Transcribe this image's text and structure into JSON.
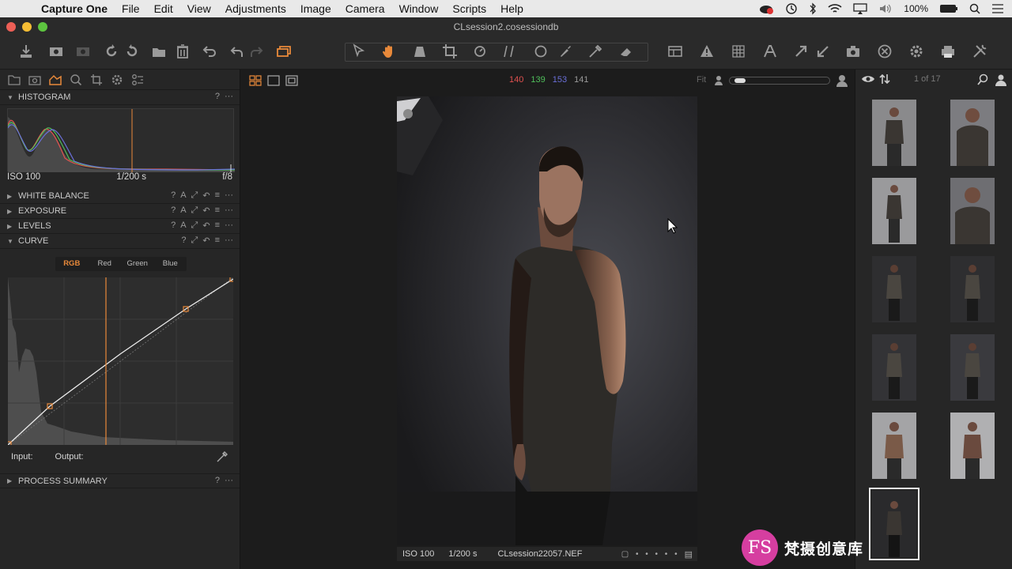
{
  "menubar": {
    "items": [
      "Capture One",
      "File",
      "Edit",
      "View",
      "Adjustments",
      "Image",
      "Camera",
      "Window",
      "Scripts",
      "Help"
    ],
    "battery": "100%"
  },
  "window": {
    "title": "CLsession2.cosessiondb"
  },
  "histogram": {
    "title": "HISTOGRAM",
    "iso": "ISO 100",
    "shutter": "1/200 s",
    "aperture": "f/8"
  },
  "tools": {
    "white_balance": "WHITE BALANCE",
    "exposure": "EXPOSURE",
    "levels": "LEVELS",
    "curve": "CURVE",
    "process_summary": "PROCESS SUMMARY",
    "help": "?",
    "more": "···",
    "auto": "A"
  },
  "curve": {
    "tabs": [
      "RGB",
      "Red",
      "Green",
      "Blue"
    ],
    "active_tab": "RGB",
    "input_label": "Input:",
    "output_label": "Output:"
  },
  "viewer": {
    "readout": {
      "r": "140",
      "g": "139",
      "b": "153",
      "l": "141"
    },
    "zoom_label": "Fit",
    "caption": {
      "iso": "ISO 100",
      "shutter": "1/200 s",
      "filename": "CLsession22057.NEF"
    }
  },
  "browser": {
    "counter": "1 of 17",
    "thumb_count": 11
  },
  "watermark": {
    "logo": "FS",
    "text": "梵摄创意库"
  },
  "colors": {
    "accent": "#e8893a",
    "red": "#e0514f",
    "green": "#4fbf5a",
    "blue": "#6a6fd8",
    "panel": "#262626"
  }
}
